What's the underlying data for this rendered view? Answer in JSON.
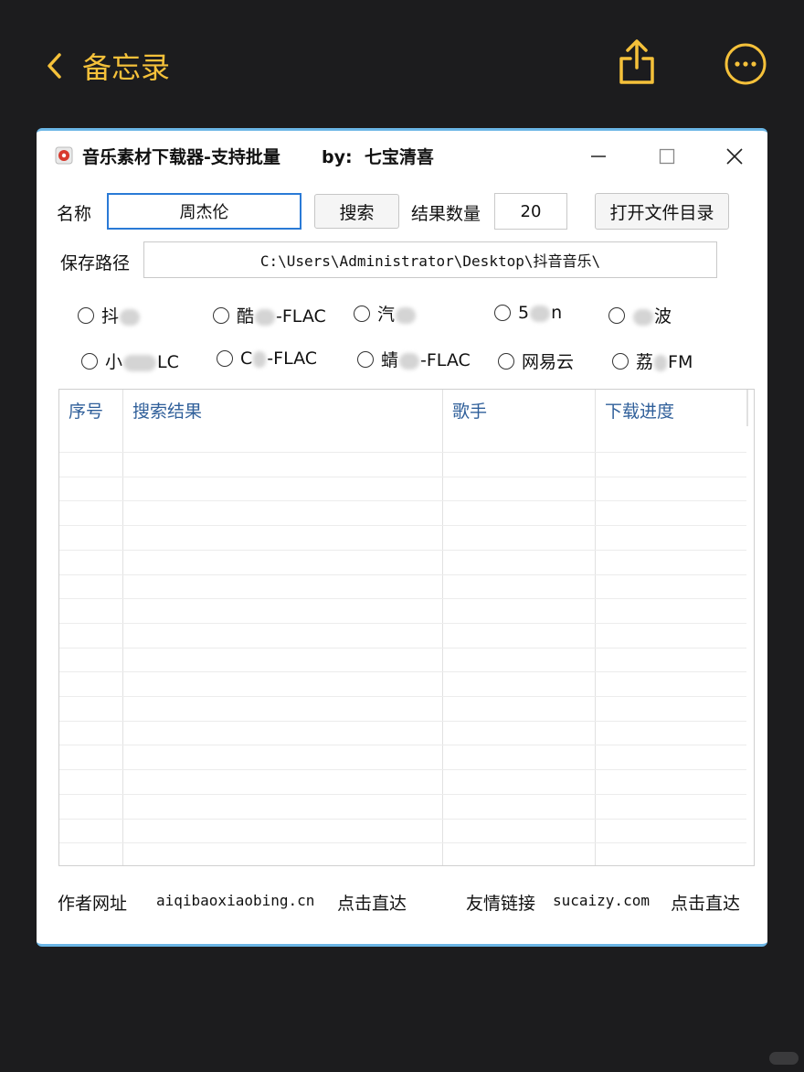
{
  "ios": {
    "back_label": "备忘录",
    "accent": "#f5c13a"
  },
  "window": {
    "title": "音乐素材下载器-支持批量",
    "author": "by:  七宝清喜",
    "accent_border": "#6bb6e6"
  },
  "form": {
    "name_label": "名称",
    "name_value": "周杰伦",
    "search_button": "搜索",
    "count_label": "结果数量",
    "count_value": "20",
    "open_dir_button": "打开文件目录",
    "path_label": "保存路径",
    "path_value": "C:\\Users\\Administrator\\Desktop\\抖音音乐\\"
  },
  "sources": {
    "row1": [
      {
        "pre": "抖",
        "post": ""
      },
      {
        "pre": "酷",
        "post": "-FLAC"
      },
      {
        "pre": "汽",
        "post": ""
      },
      {
        "pre": "5",
        "post": "n"
      },
      {
        "pre": "",
        "post": "波"
      }
    ],
    "row2": [
      {
        "pre": "小",
        "post": "LC"
      },
      {
        "pre": "C",
        "post": "-FLAC"
      },
      {
        "pre": "蜻",
        "post": "-FLAC"
      },
      {
        "pre": "网易云",
        "post": ""
      },
      {
        "pre": "荔",
        "post": "FM"
      }
    ]
  },
  "table": {
    "columns": [
      "序号",
      "搜索结果",
      "歌手",
      "下载进度"
    ],
    "header_color": "#2f5f9a"
  },
  "footer": {
    "author_site_label": "作者网址",
    "author_site_url": "aiqibaoxiaobing.cn",
    "author_go": "点击直达",
    "friend_link_label": "友情链接",
    "friend_link_url": "sucaizy.com",
    "friend_go": "点击直达"
  }
}
